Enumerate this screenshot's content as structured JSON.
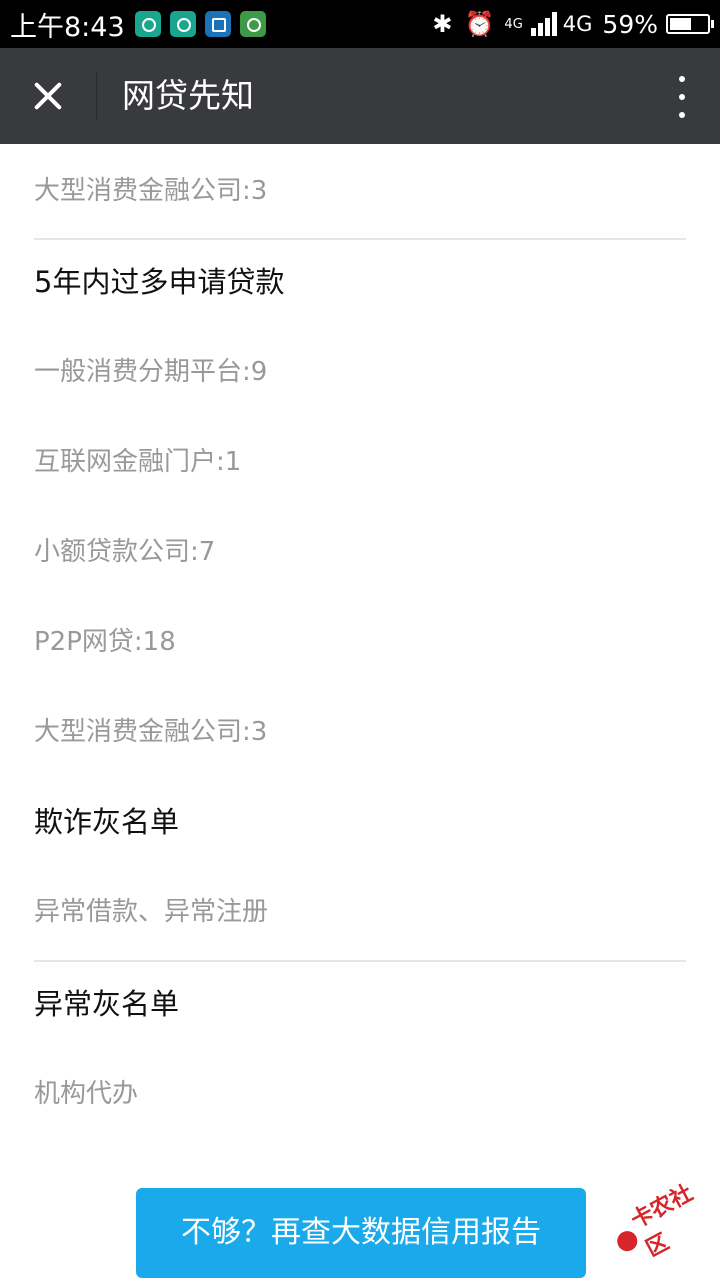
{
  "status_bar": {
    "time": "上午8:43",
    "network_small": "4G",
    "network": "4G",
    "battery_percent": "59%",
    "battery_level": 0.59,
    "icons": [
      "app-icon",
      "app-icon",
      "scan-icon",
      "wifi-hotspot-icon",
      "bluetooth-icon",
      "alarm-icon",
      "signal-icon",
      "battery-icon"
    ]
  },
  "title_bar": {
    "title": "网贷先知",
    "close_icon": "close-icon",
    "more_icon": "more-vertical-icon"
  },
  "content": {
    "top_item": "大型消费金融公司:3",
    "section_loans": {
      "heading": "5年内过多申请贷款",
      "items": [
        "一般消费分期平台:9",
        "互联网金融门户:1",
        "小额贷款公司:7",
        "P2P网贷:18",
        "大型消费金融公司:3"
      ]
    },
    "section_fraud": {
      "heading": "欺诈灰名单",
      "items": [
        "异常借款、异常注册"
      ]
    },
    "section_abnormal": {
      "heading": "异常灰名单",
      "items": [
        "机构代办"
      ]
    }
  },
  "cta_button": "不够？再查大数据信用报告",
  "watermark": "卡农社区",
  "colors": {
    "title_bar_bg": "#393a3e",
    "cta_bg": "#1aa9ea",
    "sub_text": "#999999",
    "watermark": "#d7262a"
  }
}
